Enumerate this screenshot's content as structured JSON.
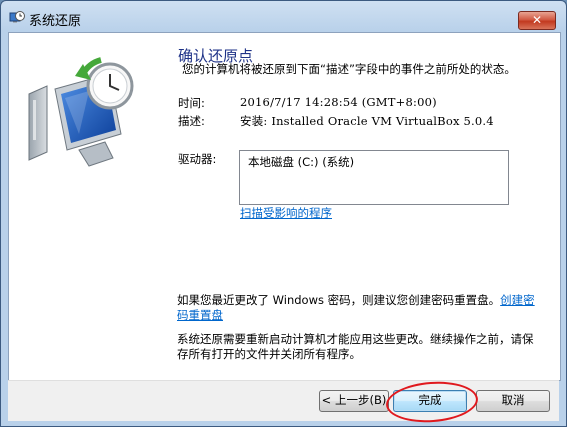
{
  "window": {
    "title": "系统还原",
    "close_glyph": "✕",
    "app_icon": "system-restore-icon"
  },
  "main": {
    "heading": "确认还原点",
    "subtitle": "您的计算机将被还原到下面“描述”字段中的事件之前所处的状态。",
    "time_label": "时间:",
    "time_value": "2016/7/17 14:28:54 (GMT+8:00)",
    "desc_label": "描述:",
    "desc_value": "安装: Installed Oracle VM VirtualBox 5.0.4",
    "drives_label": "驱动器:",
    "drives": [
      "本地磁盘 (C:) (系统)"
    ],
    "scan_link": "扫描受影响的程序",
    "password_note": "如果您最近更改了 Windows 密码，则建议您创建密码重置盘。",
    "password_link": "创建密码重置盘",
    "restart_note": "系统还原需要重新启动计算机才能应用这些更改。继续操作之前，请保存所有打开的文件并关闭所有程序。"
  },
  "buttons": {
    "back": "< 上一步(B)",
    "finish": "完成",
    "cancel": "取消"
  },
  "colors": {
    "heading": "#1e3287",
    "link": "#0066cc",
    "annotation": "#e0191e"
  }
}
